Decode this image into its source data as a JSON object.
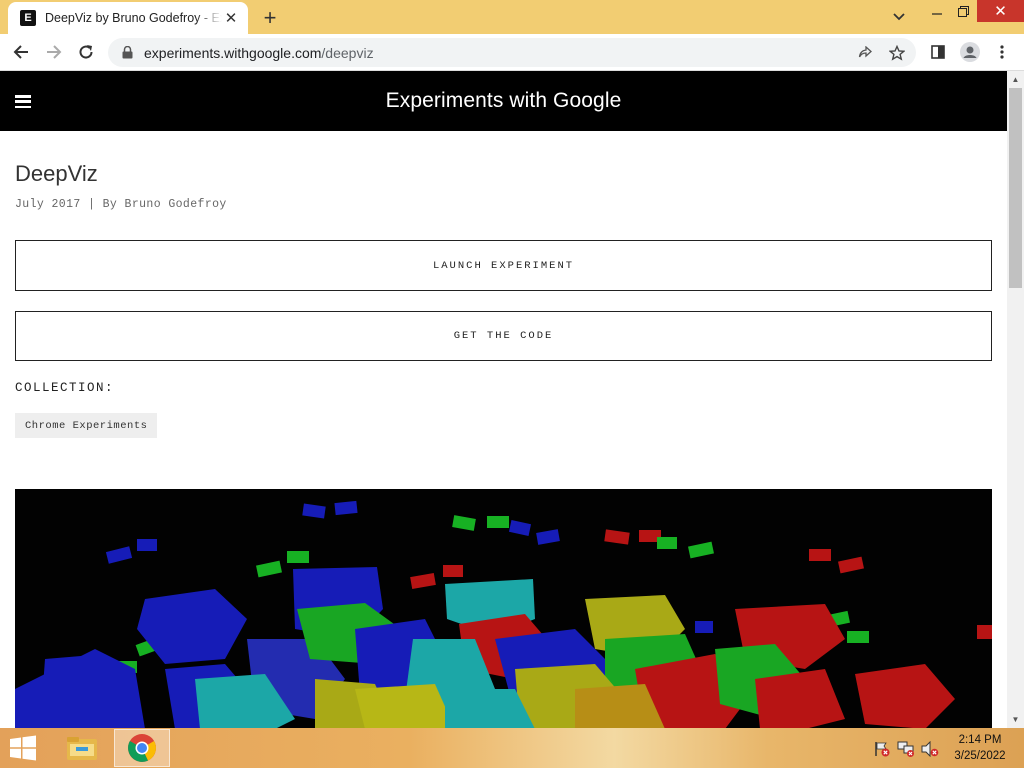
{
  "browser": {
    "tab": {
      "favicon_letter": "E",
      "title": "DeepViz by Bruno Godefroy - Experiments with Google",
      "close_icon": "close-icon"
    },
    "address": {
      "host": "experiments.withgoogle.com",
      "path": "/deepviz"
    },
    "accent_color": "#f2cd72"
  },
  "site": {
    "header_title": "Experiments with Google",
    "header_bg": "#000000"
  },
  "experiment": {
    "title": "DeepViz",
    "byline": "July 2017 | By Bruno Godefroy",
    "launch_label": "LAUNCH EXPERIMENT",
    "code_label": "GET THE CODE",
    "collection_label": "COLLECTION:",
    "collection_chip": "Chrome Experiments"
  },
  "taskbar": {
    "time": "2:14 PM",
    "date": "3/25/2022"
  }
}
